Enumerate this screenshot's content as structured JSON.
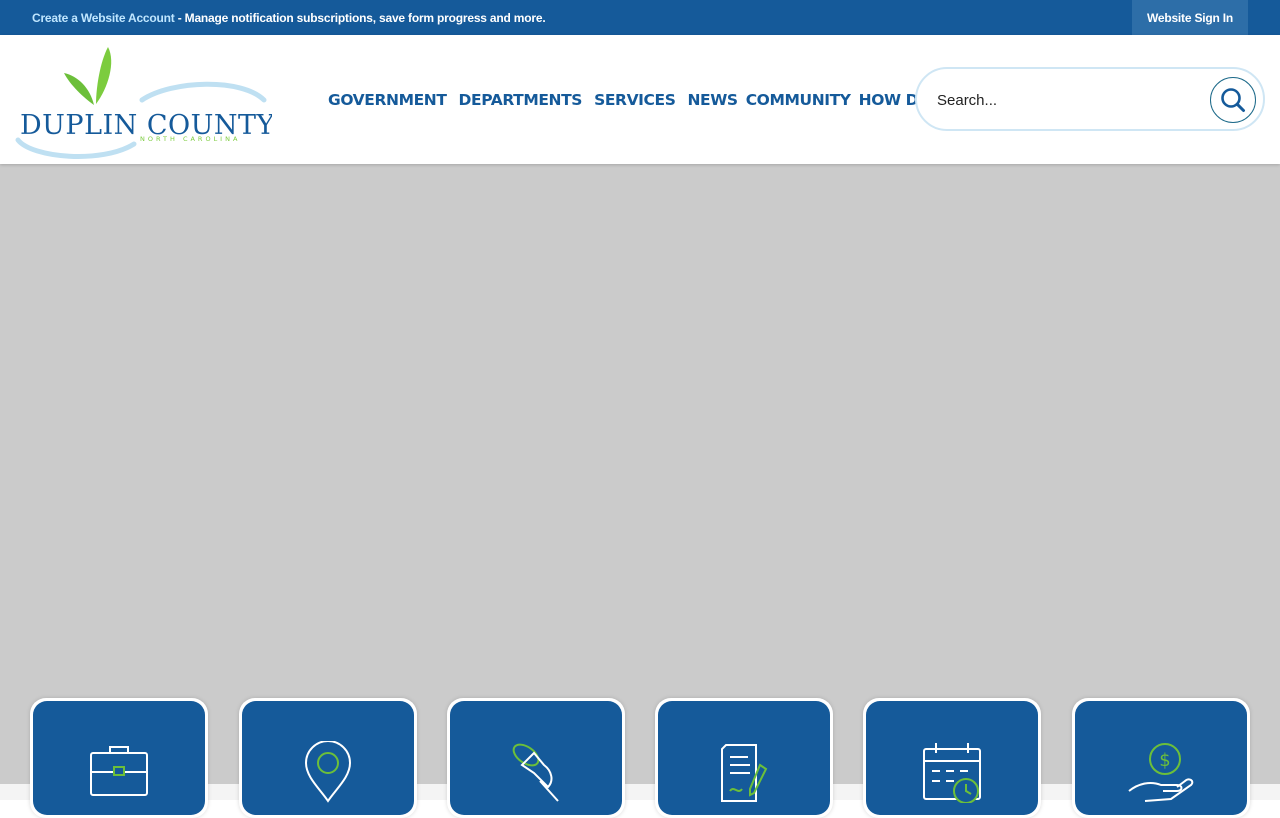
{
  "topbar": {
    "create_account_link": "Create a Website Account",
    "message": " - Manage notification subscriptions, save form progress and more.",
    "signin_label": "Website Sign In"
  },
  "logo": {
    "name": "DUPLIN COUNTY",
    "subtitle": "NORTH CAROLINA"
  },
  "nav": {
    "items": [
      "GOVERNMENT",
      "DEPARTMENTS",
      "SERVICES",
      "NEWS",
      "COMMUNITY",
      "HOW DO I..."
    ]
  },
  "search": {
    "placeholder": "Search..."
  },
  "tiles": [
    {
      "icon": "briefcase-icon"
    },
    {
      "icon": "map-pin-icon"
    },
    {
      "icon": "pushpin-icon"
    },
    {
      "icon": "document-sign-icon"
    },
    {
      "icon": "calendar-clock-icon"
    },
    {
      "icon": "hand-dollar-icon"
    }
  ],
  "colors": {
    "brand_blue": "#155a9a",
    "accent_green": "#6cbf3a",
    "hero_gray": "#cbcbcb"
  }
}
